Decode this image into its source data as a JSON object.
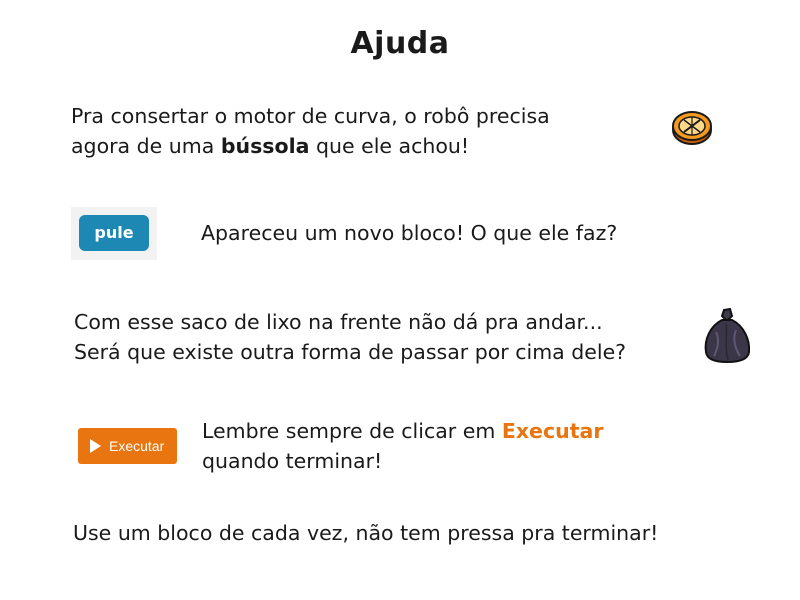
{
  "title": "Ajuda",
  "items": [
    {
      "line1": "Pra consertar o motor de curva, o robô precisa",
      "line2_pre": "agora de uma ",
      "line2_bold": "bússola",
      "line2_post": " que ele achou!",
      "icon": "compass-icon"
    },
    {
      "block_label": "pule",
      "text": "Apareceu um novo bloco! O que ele faz?"
    },
    {
      "line1": "Com esse saco de lixo na frente não dá pra andar...",
      "line2": "Será que existe outra forma de passar por cima dele?",
      "icon": "trash-bag-icon"
    },
    {
      "button_label": "Executar",
      "line1_pre": "Lembre sempre de clicar em ",
      "line1_highlight": "Executar",
      "line2": "quando terminar!"
    },
    {
      "text": "Use um bloco de cada vez, não tem pressa pra terminar!"
    }
  ],
  "colors": {
    "accent_orange": "#e8750f",
    "block_blue": "#1e88b4"
  }
}
